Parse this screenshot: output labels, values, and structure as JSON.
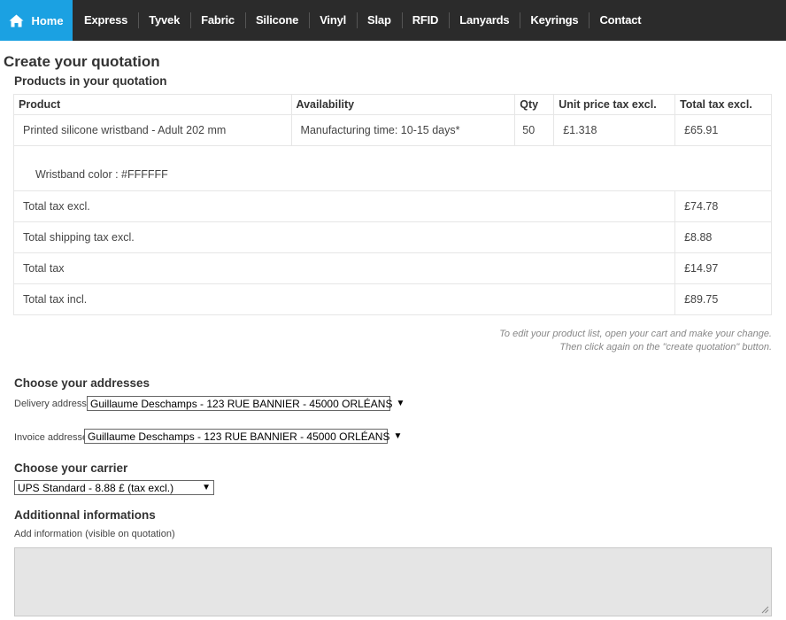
{
  "nav": {
    "home_label": "Home",
    "items": [
      {
        "label": "Express"
      },
      {
        "label": "Tyvek"
      },
      {
        "label": "Fabric"
      },
      {
        "label": "Silicone"
      },
      {
        "label": "Vinyl"
      },
      {
        "label": "Slap"
      },
      {
        "label": "RFID"
      },
      {
        "label": "Lanyards"
      },
      {
        "label": "Keyrings"
      },
      {
        "label": "Contact"
      }
    ]
  },
  "page_title": "Create your quotation",
  "products_title": "Products in your quotation",
  "table": {
    "headers": {
      "product": "Product",
      "availability": "Availability",
      "qty": "Qty",
      "unit_price": "Unit price tax excl.",
      "total": "Total tax excl."
    },
    "product_row": {
      "product": "Printed silicone wristband - Adult 202 mm",
      "availability": "Manufacturing time: 10-15 days*",
      "qty": "50",
      "unit_price": "£1.318",
      "total": "£65.91"
    },
    "color_row": "Wristband color : #FFFFFF",
    "totals": [
      {
        "label": "Total tax excl.",
        "value": "£74.78"
      },
      {
        "label": "Total shipping tax excl.",
        "value": "£8.88"
      },
      {
        "label": "Total tax",
        "value": "£14.97"
      },
      {
        "label": "Total tax incl.",
        "value": "£89.75"
      }
    ]
  },
  "note": {
    "line1": "To edit your product list, open your cart and make your change.",
    "line2": "Then click again on the \"create quotation\" button."
  },
  "addresses": {
    "title": "Choose your addresses",
    "delivery_label": "Delivery addresse",
    "delivery_value": "Guillaume Deschamps - 123 RUE BANNIER - 45000 ORLÉANS",
    "invoice_label": "Invoice addresse",
    "invoice_value": "Guillaume Deschamps - 123 RUE BANNIER - 45000 ORLÉANS"
  },
  "carrier": {
    "title": "Choose your carrier",
    "value": "UPS Standard - 8.88 £ (tax excl.)"
  },
  "additional": {
    "title": "Additionnal informations",
    "label": "Add information (visible on quotation)"
  },
  "icons": {
    "home": "home-icon",
    "dropdown": "dropdown-arrow-icon",
    "resize": "resize-handle-icon"
  },
  "colors": {
    "nav_bg": "#2b2b2b",
    "accent": "#1ba1e2"
  }
}
